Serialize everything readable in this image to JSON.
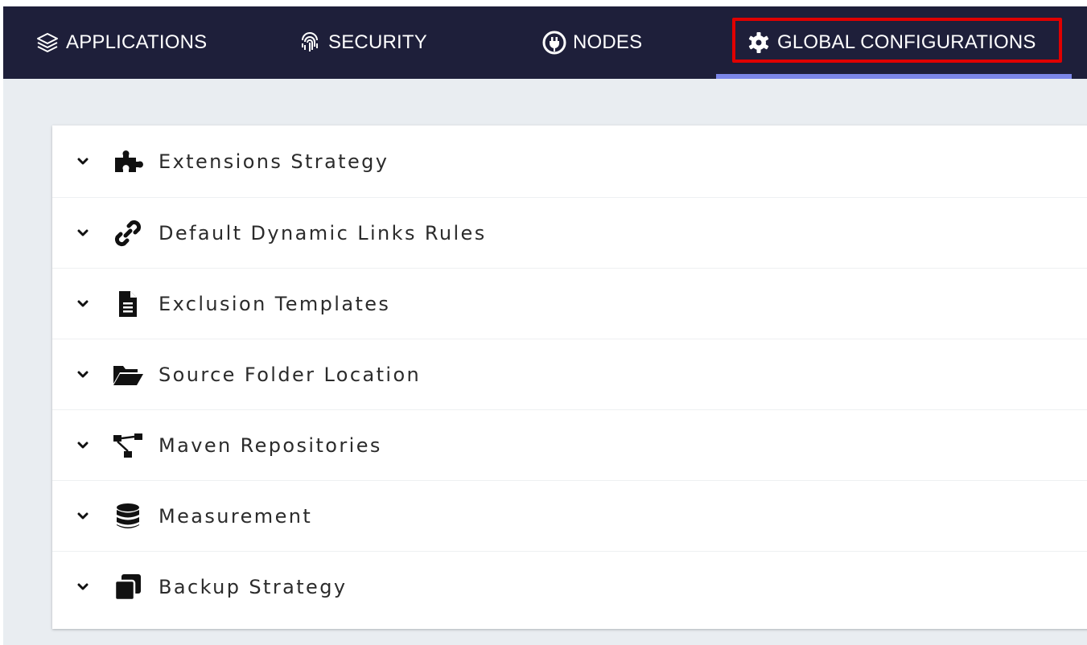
{
  "colors": {
    "nav_bg": "#1e1f3a",
    "active_underline": "#7b86e8",
    "highlight": "#e00000",
    "page_bg": "#e9edf1",
    "panel_bg": "#ffffff"
  },
  "nav": {
    "tabs": [
      {
        "label": "APPLICATIONS",
        "icon": "layers-icon"
      },
      {
        "label": "SECURITY",
        "icon": "fingerprint-icon"
      },
      {
        "label": "NODES",
        "icon": "plug-icon"
      },
      {
        "label": "GLOBAL CONFIGURATIONS",
        "icon": "gear-icon",
        "active": true
      }
    ]
  },
  "sections": [
    {
      "label": "Extensions Strategy",
      "icon": "puzzle-icon"
    },
    {
      "label": "Default Dynamic Links Rules",
      "icon": "link-icon"
    },
    {
      "label": "Exclusion Templates",
      "icon": "file-icon"
    },
    {
      "label": "Source Folder Location",
      "icon": "folder-open-icon"
    },
    {
      "label": "Maven Repositories",
      "icon": "sitemap-icon"
    },
    {
      "label": "Measurement",
      "icon": "database-icon"
    },
    {
      "label": "Backup Strategy",
      "icon": "copy-icon"
    }
  ]
}
